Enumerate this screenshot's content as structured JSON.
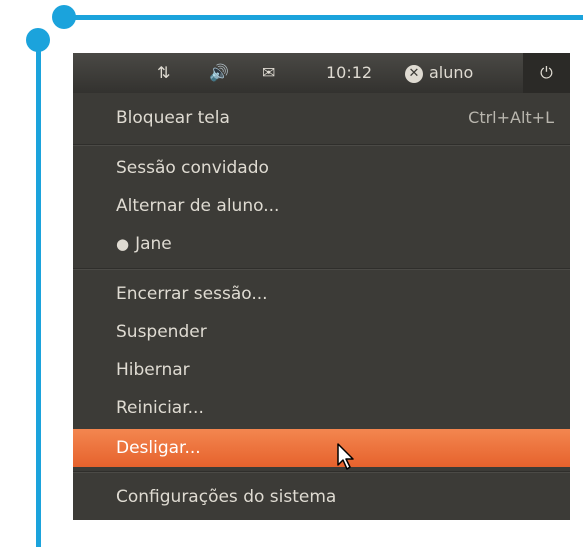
{
  "topbar": {
    "network_icon": "⇅",
    "volume_icon": "🔊",
    "mail_icon": "✉",
    "clock": "10:12",
    "user_badge_icon": "✕",
    "user": "aluno",
    "power_icon": "⏻"
  },
  "menu": {
    "lock": {
      "label": "Bloquear tela",
      "accel": "Ctrl+Alt+L"
    },
    "guest": "Sessão convidado",
    "switch_user": "Alternar de aluno...",
    "jane": "Jane",
    "logout": "Encerrar sessão...",
    "suspend": "Suspender",
    "hibernate": "Hibernar",
    "restart": "Reiniciar...",
    "shutdown": "Desligar...",
    "settings": "Configurações do sistema"
  },
  "colors": {
    "callout": "#1ba3dc",
    "highlight": "#e6622d",
    "panel": "#3c3b37"
  }
}
